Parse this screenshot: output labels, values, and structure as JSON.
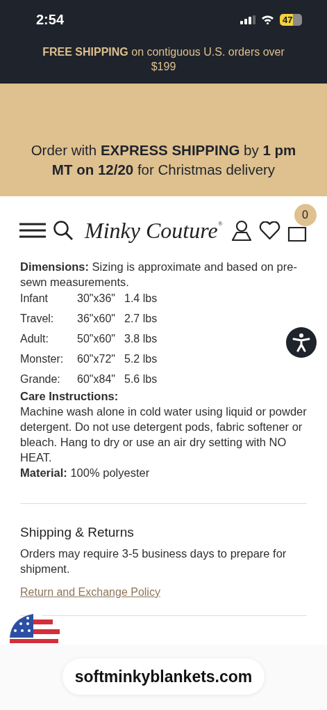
{
  "status_bar": {
    "time": "2:54",
    "battery": "47"
  },
  "promo_bar": {
    "text": "**FREE SHIPPING** on contiguous U.S. orders over $199"
  },
  "banner": {
    "text": "Order with **EXPRESS SHIPPING** by **1 pm MT on 12/20** for Christmas delivery"
  },
  "header": {
    "logo": "Minky Couture",
    "logo_mark": "®",
    "cart_count": "0"
  },
  "details": {
    "dimensions": {
      "label": "Dimensions:",
      "text": "Sizing is approximate and based on pre-sewn measurements."
    },
    "sizes": [
      {
        "name": "Infant",
        "size": "30\"x36\"",
        "weight": "1.4 lbs"
      },
      {
        "name": "Travel:",
        "size": "36\"x60\"",
        "weight": "2.7 lbs"
      },
      {
        "name": "Adult:",
        "size": "50\"x60\"",
        "weight": "3.8 lbs"
      },
      {
        "name": "Monster:",
        "size": "60\"x72\"",
        "weight": "5.2 lbs"
      },
      {
        "name": "Grande:",
        "size": "60\"x84\"",
        "weight": "5.6 lbs"
      }
    ],
    "care_title": "Care Instructions:",
    "care_text": "Machine wash alone in cold water using liquid or powder detergent. Do not use detergent pods, fabric softener or bleach. Hang to dry or use an air dry setting with NO HEAT.",
    "material": {
      "label": "Material:",
      "text": "100% polyester"
    }
  },
  "shipping": {
    "title": "Shipping & Returns",
    "text": "Orders may require 3-5 business days to prepare for shipment.",
    "link": "Return and Exchange Policy"
  },
  "browser": {
    "url": "softminkyblankets.com"
  }
}
